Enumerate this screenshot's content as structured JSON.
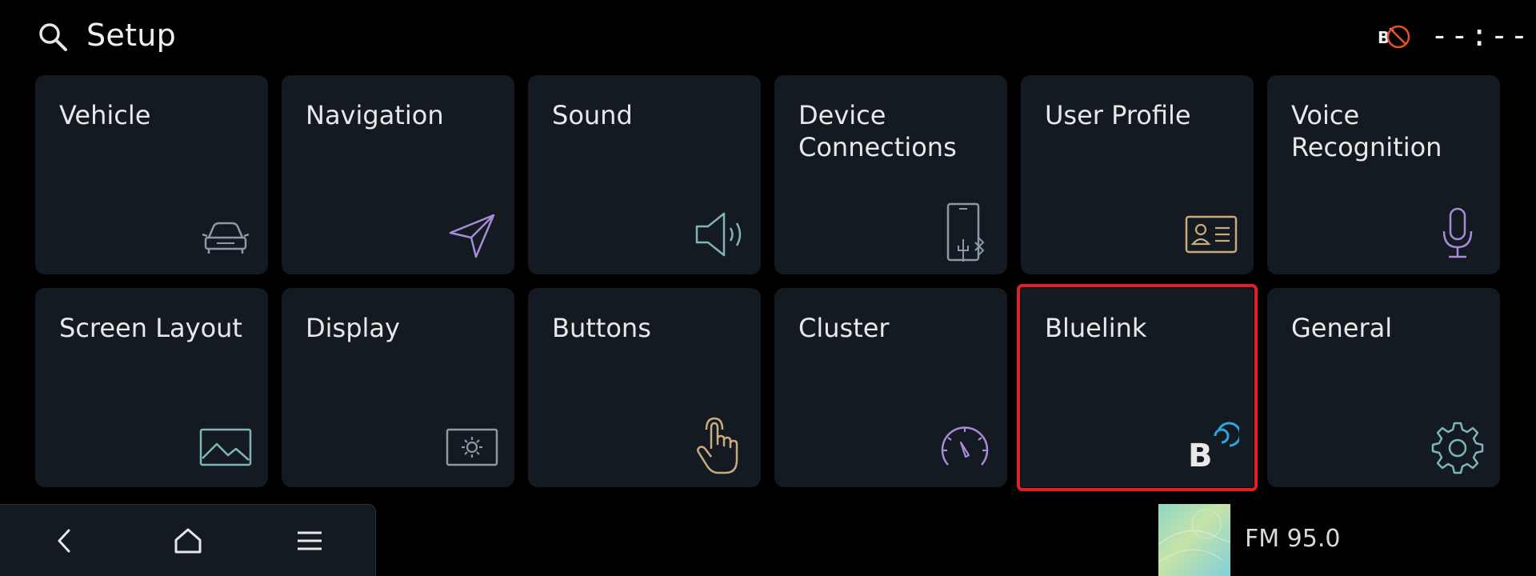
{
  "header": {
    "title": "Setup",
    "clock": "--:--",
    "search_icon": "search-icon",
    "status_icon": "bluelink-disconnected-icon"
  },
  "tiles": [
    {
      "label": "Vehicle",
      "icon": "car-icon"
    },
    {
      "label": "Navigation",
      "icon": "navigation-arrow-icon"
    },
    {
      "label": "Sound",
      "icon": "speaker-icon"
    },
    {
      "label": "Device Connections",
      "icon": "phone-usb-bluetooth-icon"
    },
    {
      "label": "User Profile",
      "icon": "id-card-icon"
    },
    {
      "label": "Voice Recognition",
      "icon": "microphone-icon"
    },
    {
      "label": "Screen Layout",
      "icon": "image-layout-icon"
    },
    {
      "label": "Display",
      "icon": "brightness-screen-icon"
    },
    {
      "label": "Buttons",
      "icon": "touch-hand-icon"
    },
    {
      "label": "Cluster",
      "icon": "speedometer-icon"
    },
    {
      "label": "Bluelink",
      "icon": "bluelink-icon",
      "selected": true
    },
    {
      "label": "General",
      "icon": "gear-icon"
    }
  ],
  "bottom_nav": {
    "back_icon": "back-icon",
    "home_icon": "home-icon",
    "menu_icon": "menu-icon"
  },
  "media": {
    "station": "FM 95.0"
  },
  "colors": {
    "background": "#000000",
    "tile": "#141a21",
    "selection": "#e01f26",
    "icon_grey": "#8a9aa6",
    "icon_purple": "#a78bd6",
    "icon_teal": "#7fb5b5",
    "icon_tan": "#c8ab80",
    "bluelink_blue": "#2aa6e0"
  }
}
